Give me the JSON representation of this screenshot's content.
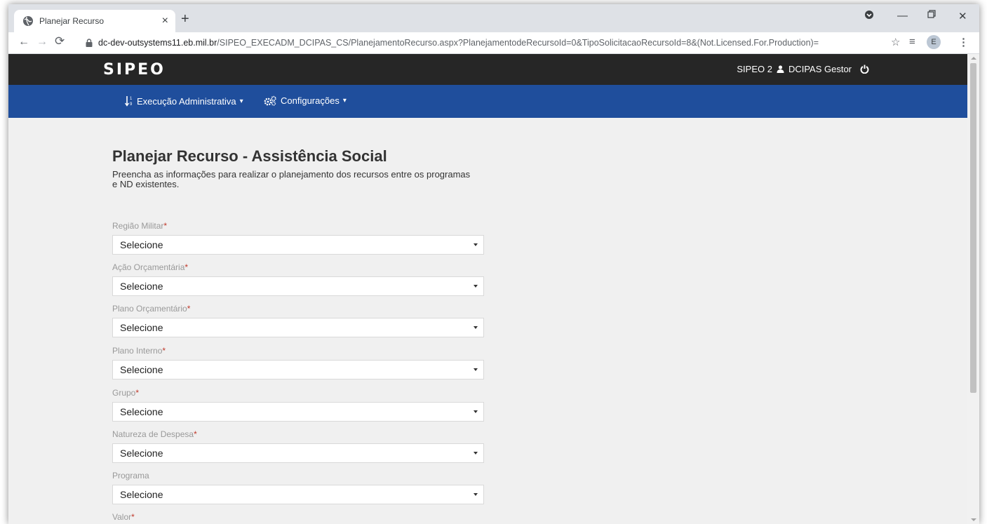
{
  "browser": {
    "tab_title": "Planejar Recurso",
    "url_host": "dc-dev-outsystems11.eb.mil.br",
    "url_path": "/SIPEO_EXECADM_DCIPAS_CS/PlanejamentoRecurso.aspx?PlanejamentodeRecursoId=0&TipoSolicitacaoRecursoId=8&(Not.Licensed.For.Production)=",
    "profile_initial": "E"
  },
  "header": {
    "logo": "SIPEO",
    "system": "SIPEO 2",
    "user": "DCIPAS Gestor"
  },
  "nav": {
    "menu1": "Execução Administrativa",
    "menu2": "Configurações"
  },
  "page": {
    "title": "Planejar Recurso - Assistência Social",
    "intro": "Preencha as informações para realizar o planejamento dos recursos entre os programas e ND existentes."
  },
  "form": {
    "f1_label": "Região Militar",
    "f1_value": "Selecione",
    "f2_label": "Ação Orçamentária",
    "f2_value": "Selecione",
    "f3_label": "Plano Orçamentário",
    "f3_value": "Selecione",
    "f4_label": "Plano Interno",
    "f4_value": "Selecione",
    "f5_label": "Grupo",
    "f5_value": "Selecione",
    "f6_label": "Natureza de Despesa",
    "f6_value": "Selecione",
    "f7_label": "Programa",
    "f7_value": "Selecione",
    "f8_label": "Valor",
    "required_mark": "*"
  },
  "colors": {
    "header_bg": "#262626",
    "nav_bg": "#1f4e9c",
    "page_bg": "#f0f0f0"
  }
}
